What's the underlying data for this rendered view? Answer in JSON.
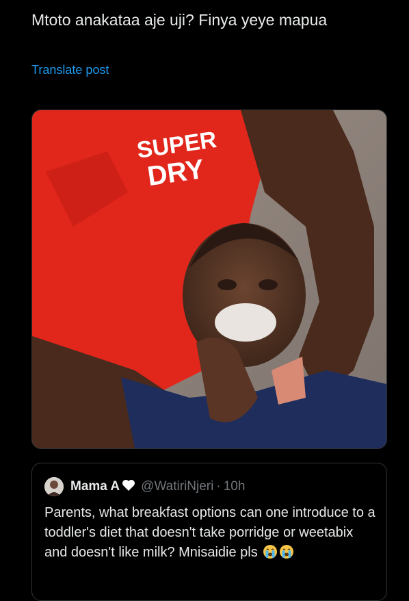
{
  "post": {
    "text": "Mtoto anakataa aje uji?  Finya yeye mapua",
    "translate_label": "Translate post",
    "media": {
      "shirt_print": "SUPER DRY",
      "icon": "photo-of-child-being-fed"
    }
  },
  "quoted_post": {
    "display_name": "Mama A",
    "name_badge_icon": "white-heart-icon",
    "handle": "@WatiriNjeri",
    "separator": "·",
    "time": "10h",
    "text": "Parents, what breakfast options can one introduce to a toddler's diet that doesn't take porridge or weetabix and doesn't like milk? Mnisaidie pls",
    "trailing_emoji": [
      "crying-face-icon",
      "crying-face-icon"
    ]
  },
  "colors": {
    "background": "#000000",
    "text": "#e7e9ea",
    "link": "#1d9bf0",
    "muted": "#71767b",
    "border": "#2f3336"
  }
}
